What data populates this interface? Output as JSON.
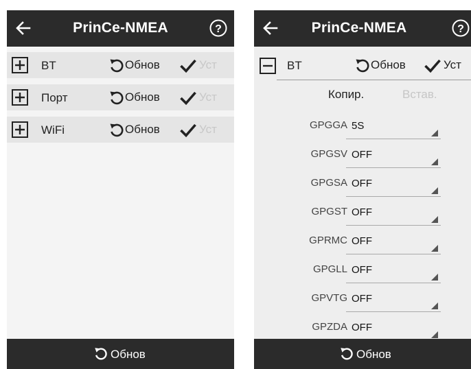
{
  "left": {
    "title": "PrinCe-NMEA",
    "rows": [
      {
        "label": "BT",
        "refresh": "Обнов",
        "apply": "Уст"
      },
      {
        "label": "Порт",
        "refresh": "Обнов",
        "apply": "Уст"
      },
      {
        "label": "WiFi",
        "refresh": "Обнов",
        "apply": "Уст"
      }
    ],
    "bottom_refresh": "Обнов"
  },
  "right": {
    "title": "PrinCe-NMEA",
    "bt_row": {
      "label": "BT",
      "refresh": "Обнов",
      "apply": "Уст"
    },
    "copy": "Копир.",
    "paste": "Встав.",
    "nmea": [
      {
        "name": "GPGGA",
        "value": "5S"
      },
      {
        "name": "GPGSV",
        "value": "OFF"
      },
      {
        "name": "GPGSA",
        "value": "OFF"
      },
      {
        "name": "GPGST",
        "value": "OFF"
      },
      {
        "name": "GPRMC",
        "value": "OFF"
      },
      {
        "name": "GPGLL",
        "value": "OFF"
      },
      {
        "name": "GPVTG",
        "value": "OFF"
      },
      {
        "name": "GPZDA",
        "value": "OFF"
      }
    ],
    "bottom_refresh": "Обнов"
  },
  "colors": {
    "bar": "#2b2b2b",
    "row": "#e5e5e5",
    "disabled": "#c8c8c8"
  }
}
